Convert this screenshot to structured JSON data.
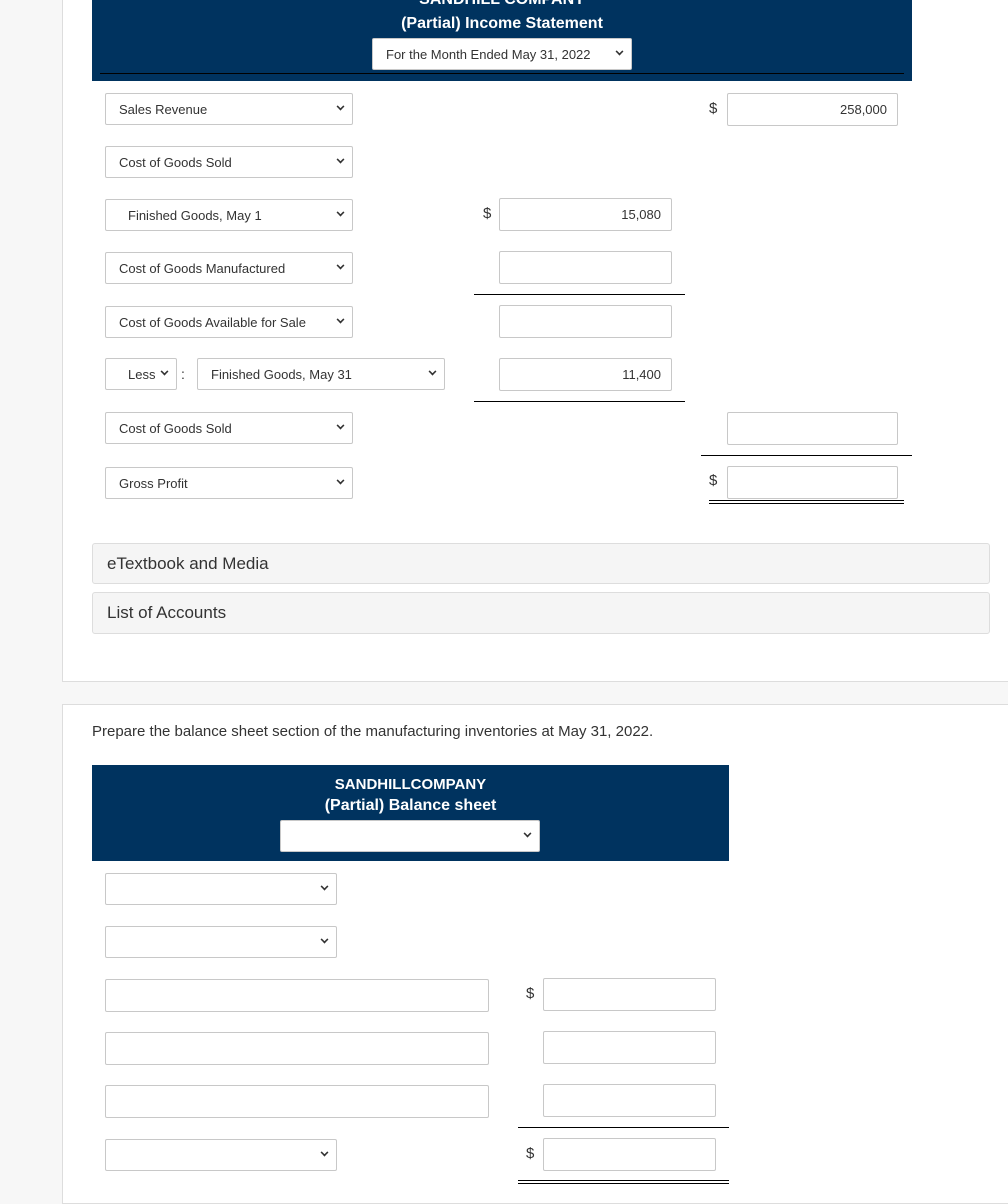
{
  "income": {
    "company": "SANDHILL COMPANY",
    "title": "(Partial) Income Statement",
    "period": "For the Month Ended May 31, 2022",
    "rows": {
      "sales": "Sales Revenue",
      "sales_value": "258,000",
      "cogs_head": "Cost of Goods Sold",
      "fg_may1": "Finished Goods, May 1",
      "fg_may1_value": "15,080",
      "cogm": "Cost of Goods Manufactured",
      "cogafs": "Cost of Goods Available for Sale",
      "less": "Less",
      "colon": ":",
      "fg_may31": "Finished Goods, May 31",
      "fg_may31_value": "11,400",
      "cogs": "Cost of Goods Sold",
      "gross": "Gross Profit"
    },
    "currency": "$"
  },
  "links": {
    "etextbook": "eTextbook and Media",
    "accounts": "List of Accounts"
  },
  "balance": {
    "prompt": "Prepare the balance sheet section of the manufacturing inventories at May 31, 2022.",
    "company": "SANDHILLCOMPANY",
    "title": "(Partial) Balance sheet",
    "currency": "$"
  },
  "colors": {
    "header": "#00335f"
  }
}
